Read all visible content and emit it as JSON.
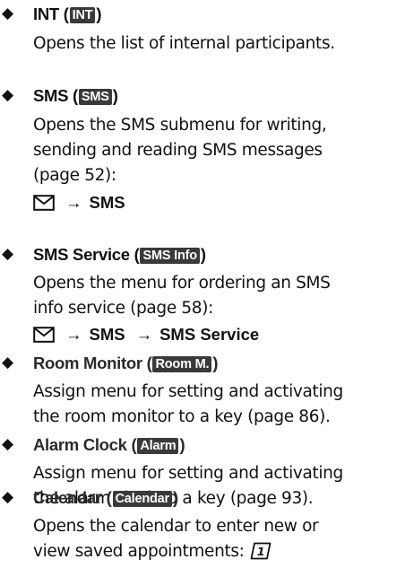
{
  "entries": [
    {
      "title": "INT",
      "badge": "INT",
      "lines": [
        "Opens the list of internal participants."
      ]
    },
    {
      "title": "SMS",
      "badge": "SMS",
      "lines": [
        "Opens the SMS submenu for writing,",
        "sending and reading SMS messages",
        "(page 52):"
      ],
      "path": [
        "SMS"
      ]
    },
    {
      "title": "SMS Service",
      "badge": "SMS Info",
      "lines": [
        "Opens the menu for ordering an SMS",
        "info service (page 58):"
      ],
      "path": [
        "SMS",
        "SMS Service"
      ]
    },
    {
      "title": "Room Monitor",
      "badge": "Room M.",
      "lines": [
        "Assign menu for setting and activating",
        "the room monitor to a key (page 86)."
      ]
    },
    {
      "title": "Alarm Clock",
      "badge": "Alarm",
      "lines": [
        "Assign menu for setting and activating",
        "the alarm clock to a key (page 93)."
      ]
    },
    {
      "title": "Calendar",
      "badge": "Calendar",
      "lines": [
        "Opens the calendar to enter new or",
        "view saved appointments:"
      ]
    }
  ],
  "symbols": {
    "bullet": "◆",
    "arrow": "→",
    "open_paren": "(",
    "close_paren": ")",
    "envelope_icon": "envelope-icon",
    "calendar_key_icon": "calendar-key-1-icon",
    "calendar_key_digit": "1"
  }
}
